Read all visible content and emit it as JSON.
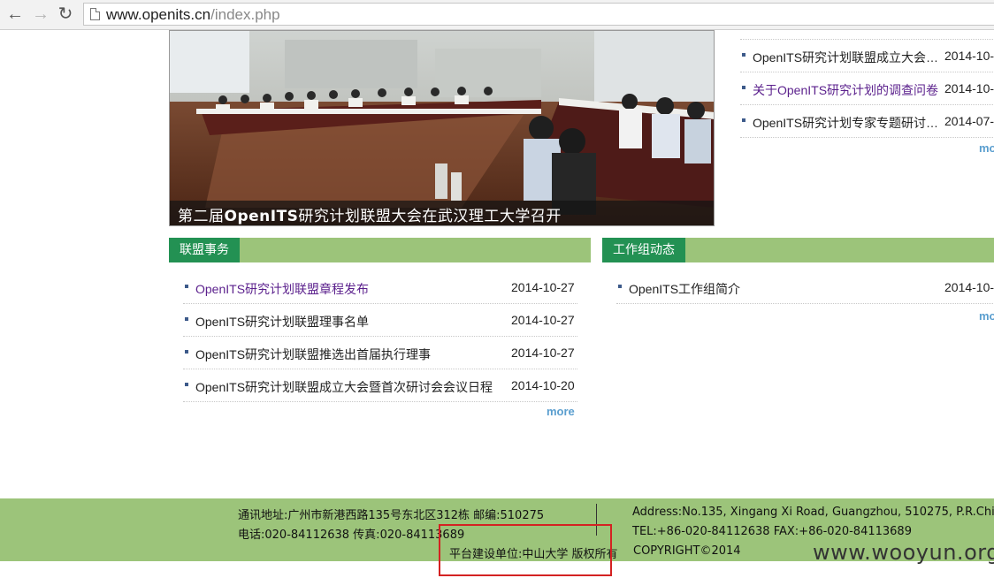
{
  "browser": {
    "url_host": "www.openits.cn",
    "url_path": "/index.php"
  },
  "hero": {
    "caption": "第二届OpenITS研究计划联盟大会在武汉理工大学召开"
  },
  "top_news": {
    "items": [
      {
        "title": "OpenITS研究计划联盟成立大会…",
        "date": "2014-10-"
      },
      {
        "title": "关于OpenITS研究计划的调查问卷",
        "date": "2014-10-"
      },
      {
        "title": "OpenITS研究计划专家专题研讨…",
        "date": "2014-07-"
      }
    ],
    "more_label": "mo"
  },
  "alliance": {
    "tab_label": "联盟事务",
    "items": [
      {
        "title": "OpenITS研究计划联盟章程发布",
        "date": "2014-10-27"
      },
      {
        "title": "OpenITS研究计划联盟理事名单",
        "date": "2014-10-27"
      },
      {
        "title": "OpenITS研究计划联盟推选出首届执行理事",
        "date": "2014-10-27"
      },
      {
        "title": "OpenITS研究计划联盟成立大会暨首次研讨会会议日程",
        "date": "2014-10-20"
      }
    ],
    "more_label": "more"
  },
  "workgroup": {
    "tab_label": "工作组动态",
    "items": [
      {
        "title": "OpenITS工作组简介",
        "date": "2014-10-"
      }
    ],
    "more_label": "mo"
  },
  "footer": {
    "address_cn": "通讯地址:广州市新港西路135号东北区312栋 邮编:510275",
    "phone_cn": "电话:020-84112638 传真:020-84113689",
    "builder_cn": "平台建设单位:中山大学 版权所有",
    "address_en": "Address:No.135, Xingang Xi Road, Guangzhou, 510275, P.R.Chi",
    "phone_en": "TEL:+86-020-84112638 FAX:+86-020-84113689",
    "copyright_en": "COPYRIGHT©2014"
  },
  "watermark": "www.wooyun.org",
  "colors": {
    "accent_green": "#239153",
    "light_green": "#9cc47a",
    "visited_link": "#5a1f8c",
    "more_link": "#5a9ecf",
    "highlight_red": "#d42222"
  }
}
